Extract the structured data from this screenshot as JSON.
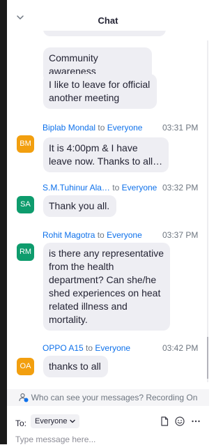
{
  "header": {
    "title": "Chat",
    "collapse_icon": "chevron-down-icon"
  },
  "messages": [
    {
      "text": "Community awareness"
    },
    {
      "text": "I like to leave for official another meeting"
    },
    {
      "sender": "Biplab Mondal",
      "to_word": "to",
      "recipient": "Everyone",
      "time": "03:31 PM",
      "initials": "BM",
      "avatar_color": "#f29f0f",
      "text": "It is 4:00pm & I have leave now. Thanks to all…"
    },
    {
      "sender": "S.M.Tuhinur Ala…",
      "to_word": "to",
      "recipient": "Everyone",
      "time": "03:32 PM",
      "initials": "SA",
      "avatar_color": "#0e9c6d",
      "text": "Thank you all."
    },
    {
      "sender": "Rohit Magotra",
      "to_word": "to",
      "recipient": "Everyone",
      "time": "03:37 PM",
      "initials": "RM",
      "avatar_color": "#0e9c6d",
      "text": "is there any representative from the health department? Can she/he shed experiences on heat related illness and mortality."
    },
    {
      "sender": "OPPO A15",
      "to_word": "to",
      "recipient": "Everyone",
      "time": "03:42 PM",
      "initials": "OA",
      "avatar_color": "#f29f0f",
      "text": "thanks to all"
    }
  ],
  "privacy_bar": {
    "text": "Who can see your messages? Recording On",
    "icon": "person-privacy-icon"
  },
  "compose": {
    "to_label": "To:",
    "recipient": "Everyone",
    "placeholder": "Type message here...",
    "file_icon": "file-icon",
    "emoji_icon": "emoji-icon",
    "more_icon": "more-icon"
  },
  "colors": {
    "accent": "#0e71eb",
    "bubble": "#eeeef3",
    "text": "#232333",
    "muted": "#6e7680"
  }
}
